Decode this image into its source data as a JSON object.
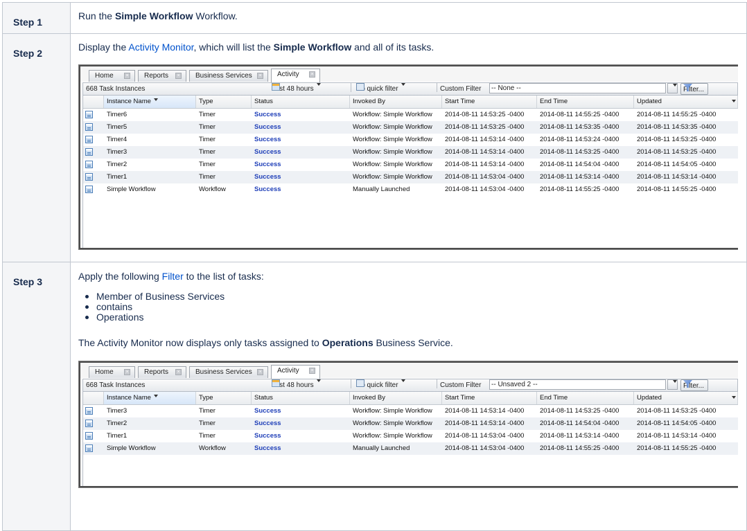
{
  "steps": [
    {
      "label": "Step 1",
      "text_before": "Run the ",
      "bold": "Simple Workflow",
      "text_after": " Workflow."
    },
    {
      "label": "Step 2",
      "text_before": "Display the ",
      "link": "Activity Monitor",
      "text_middle": ", which will list the ",
      "bold": "Simple Workflow",
      "text_after": " and all of its tasks."
    },
    {
      "label": "Step 3",
      "text_before": "Apply the following ",
      "link": "Filter",
      "text_after": " to the list of tasks:",
      "bullets": [
        "Member of Business Services",
        "contains",
        "Operations"
      ],
      "result_before": "The Activity Monitor now displays only tasks assigned to ",
      "result_bold": "Operations",
      "result_after": " Business Service."
    }
  ],
  "monitors": [
    {
      "tabs": [
        {
          "label": "Home",
          "active": false
        },
        {
          "label": "Reports",
          "active": false
        },
        {
          "label": "Business Services",
          "active": false
        },
        {
          "label": "Activity",
          "active": true
        }
      ],
      "toolbar": {
        "count": "668 Task Instances",
        "time_range": "Last 48 hours",
        "quick_filter": "No quick filter",
        "custom_filter_label": "Custom Filter",
        "custom_filter_value": "-- None --",
        "filter_button": "Filter..."
      },
      "columns": [
        "Instance Name",
        "Type",
        "Status",
        "Invoked By",
        "Start Time",
        "End Time",
        "Updated"
      ],
      "rows": [
        [
          "Timer6",
          "Timer",
          "Success",
          "Workflow: Simple Workflow",
          "2014-08-11 14:53:25 -0400",
          "2014-08-11 14:55:25 -0400",
          "2014-08-11 14:55:25 -0400"
        ],
        [
          "Timer5",
          "Timer",
          "Success",
          "Workflow: Simple Workflow",
          "2014-08-11 14:53:25 -0400",
          "2014-08-11 14:53:35 -0400",
          "2014-08-11 14:53:35 -0400"
        ],
        [
          "Timer4",
          "Timer",
          "Success",
          "Workflow: Simple Workflow",
          "2014-08-11 14:53:14 -0400",
          "2014-08-11 14:53:24 -0400",
          "2014-08-11 14:53:25 -0400"
        ],
        [
          "Timer3",
          "Timer",
          "Success",
          "Workflow: Simple Workflow",
          "2014-08-11 14:53:14 -0400",
          "2014-08-11 14:53:25 -0400",
          "2014-08-11 14:53:25 -0400"
        ],
        [
          "Timer2",
          "Timer",
          "Success",
          "Workflow: Simple Workflow",
          "2014-08-11 14:53:14 -0400",
          "2014-08-11 14:54:04 -0400",
          "2014-08-11 14:54:05 -0400"
        ],
        [
          "Timer1",
          "Timer",
          "Success",
          "Workflow: Simple Workflow",
          "2014-08-11 14:53:04 -0400",
          "2014-08-11 14:53:14 -0400",
          "2014-08-11 14:53:14 -0400"
        ],
        [
          "Simple Workflow",
          "Workflow",
          "Success",
          "Manually Launched",
          "2014-08-11 14:53:04 -0400",
          "2014-08-11 14:55:25 -0400",
          "2014-08-11 14:55:25 -0400"
        ]
      ]
    },
    {
      "tabs": [
        {
          "label": "Home",
          "active": false
        },
        {
          "label": "Reports",
          "active": false
        },
        {
          "label": "Business Services",
          "active": false
        },
        {
          "label": "Activity",
          "active": true
        }
      ],
      "toolbar": {
        "count": "668 Task Instances",
        "time_range": "Last 48 hours",
        "quick_filter": "No quick filter",
        "custom_filter_label": "Custom Filter",
        "custom_filter_value": "-- Unsaved 2 --",
        "filter_button": "Filter..."
      },
      "columns": [
        "Instance Name",
        "Type",
        "Status",
        "Invoked By",
        "Start Time",
        "End Time",
        "Updated"
      ],
      "rows": [
        [
          "Timer3",
          "Timer",
          "Success",
          "Workflow: Simple Workflow",
          "2014-08-11 14:53:14 -0400",
          "2014-08-11 14:53:25 -0400",
          "2014-08-11 14:53:25 -0400"
        ],
        [
          "Timer2",
          "Timer",
          "Success",
          "Workflow: Simple Workflow",
          "2014-08-11 14:53:14 -0400",
          "2014-08-11 14:54:04 -0400",
          "2014-08-11 14:54:05 -0400"
        ],
        [
          "Timer1",
          "Timer",
          "Success",
          "Workflow: Simple Workflow",
          "2014-08-11 14:53:04 -0400",
          "2014-08-11 14:53:14 -0400",
          "2014-08-11 14:53:14 -0400"
        ],
        [
          "Simple Workflow",
          "Workflow",
          "Success",
          "Manually Launched",
          "2014-08-11 14:53:04 -0400",
          "2014-08-11 14:55:25 -0400",
          "2014-08-11 14:55:25 -0400"
        ]
      ]
    }
  ],
  "colors": {
    "link": "#0052cc",
    "status": "#1f3fb8",
    "label_bg": "#f4f5f7"
  }
}
